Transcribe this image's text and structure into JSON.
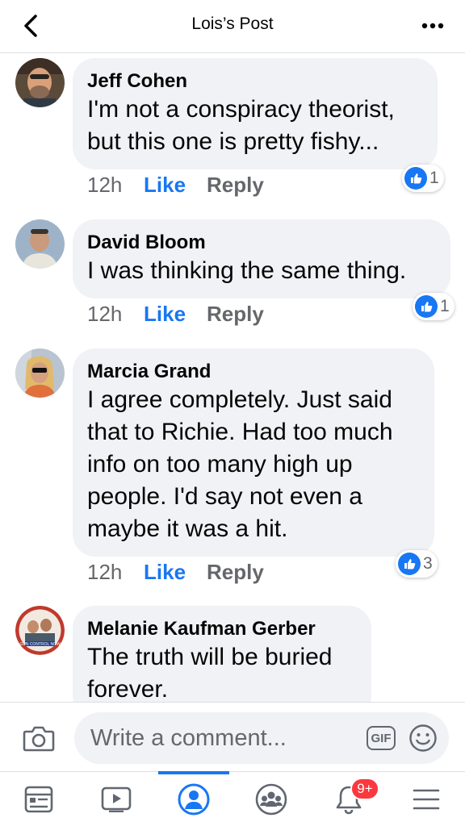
{
  "header": {
    "title": "Lois’s Post"
  },
  "comments": [
    {
      "author": "Jeff Cohen",
      "lines": [
        "I'm not a conspiracy theorist,",
        "but this one is pretty fishy..."
      ],
      "time": "12h",
      "like_label": "Like",
      "reply_label": "Reply",
      "reaction_count": "1"
    },
    {
      "author": "David Bloom",
      "lines": [
        "I was thinking the same thing."
      ],
      "time": "12h",
      "like_label": "Like",
      "reply_label": "Reply",
      "reaction_count": "1"
    },
    {
      "author": "Marcia Grand",
      "lines": [
        "I agree completely. Just said",
        "that to Richie. Had too much",
        "info on too many high up",
        "people. I'd say not even a",
        "maybe it was a hit."
      ],
      "time": "12h",
      "like_label": "Like",
      "reply_label": "Reply",
      "reaction_count": "3"
    },
    {
      "author": "Melanie Kaufman Gerber",
      "lines": [
        "The truth will be buried",
        "forever."
      ],
      "avatar_caption": "GUN CONTROL NOW"
    }
  ],
  "composer": {
    "placeholder": "Write a comment...",
    "gif_label": "GIF"
  },
  "nav": {
    "notifications_badge": "9+",
    "active_tab": "profile"
  },
  "colors": {
    "accent": "#1877f2",
    "bubble": "#f0f2f5",
    "badge": "#fa383e",
    "muted_text": "#65676b"
  },
  "icons": [
    "back-chevron-icon",
    "more-dots-icon",
    "camera-icon",
    "gif-icon",
    "emoji-icon",
    "news-feed-icon",
    "watch-icon",
    "profile-icon",
    "groups-icon",
    "bell-icon",
    "menu-icon",
    "thumbs-up-icon"
  ]
}
